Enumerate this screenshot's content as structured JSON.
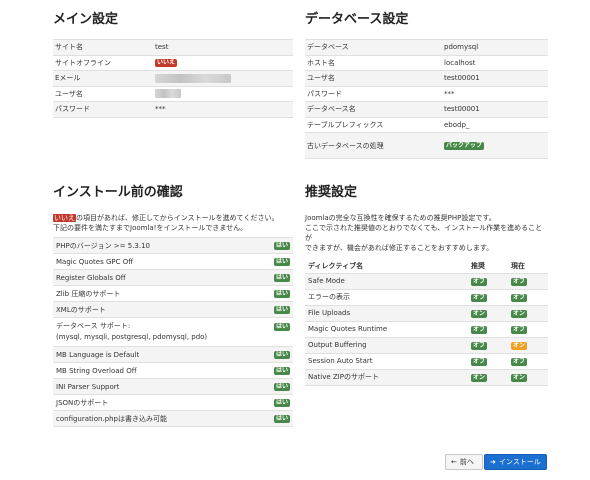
{
  "main_settings": {
    "title": "メイン設定",
    "rows": [
      {
        "label": "サイト名",
        "value": "test"
      },
      {
        "label": "サイトオフライン",
        "badge": "いいえ"
      },
      {
        "label": "Eメール"
      },
      {
        "label": "ユーザ名"
      },
      {
        "label": "パスワード",
        "value": "***"
      }
    ]
  },
  "db_settings": {
    "title": "データベース設定",
    "rows": [
      {
        "label": "データベース",
        "value": "pdomysql"
      },
      {
        "label": "ホスト名",
        "value": "localhost"
      },
      {
        "label": "ユーザ名",
        "value": "test00001"
      },
      {
        "label": "パスワード",
        "value": "***"
      },
      {
        "label": "データベース名",
        "value": "test00001"
      },
      {
        "label": "テーブルプレフィックス",
        "value": "ebodp_"
      },
      {
        "label": "古いデータベースの処理",
        "badge": "バックアップ"
      }
    ]
  },
  "preinstall": {
    "title": "インストール前の確認",
    "intro_badge": "いいえ",
    "intro_rest": "の項目があれば、修正してからインストールを進めてください。",
    "intro_line2": "下記の要件を満たすまでJoomla!をインストールできません。",
    "items": [
      {
        "label": "PHPのバージョン >= 5.3.10",
        "status": "はい"
      },
      {
        "label": "Magic Quotes GPC Off",
        "status": "はい"
      },
      {
        "label": "Register Globals Off",
        "status": "はい"
      },
      {
        "label": "Zlib 圧縮のサポート",
        "status": "はい"
      },
      {
        "label": "XMLのサポート",
        "status": "はい"
      },
      {
        "label": "データベース サポート:",
        "sub": "(mysql, mysqli, postgresql, pdomysql, pdo)",
        "status": "はい"
      },
      {
        "label": "MB Language is Default",
        "status": "はい"
      },
      {
        "label": "MB String Overload Off",
        "status": "はい"
      },
      {
        "label": "INI Parser Support",
        "status": "はい"
      },
      {
        "label": "JSONのサポート",
        "status": "はい"
      },
      {
        "label": "configuration.phpは書き込み可能",
        "status": "はい"
      }
    ]
  },
  "recommended": {
    "title": "推奨設定",
    "intro_line1": "Joomlaの完全な互換性を確保するための推奨PHP設定です。",
    "intro_line2": "ここで示された推奨値のとおりでなくても、インストール作業を進めることが",
    "intro_line3": "できますが、機会があれば修正することをおすすめします。",
    "headers": {
      "directive": "ディレクティブ名",
      "recommended": "推奨",
      "current": "現在"
    },
    "rows": [
      {
        "name": "Safe Mode",
        "rec": "オフ",
        "cur": "オフ",
        "cur_color": "#468847"
      },
      {
        "name": "エラーの表示",
        "rec": "オフ",
        "cur": "オフ",
        "cur_color": "#468847"
      },
      {
        "name": "File Uploads",
        "rec": "オン",
        "cur": "オン",
        "cur_color": "#468847"
      },
      {
        "name": "Magic Quotes Runtime",
        "rec": "オフ",
        "cur": "オフ",
        "cur_color": "#468847"
      },
      {
        "name": "Output Buffering",
        "rec": "オフ",
        "cur": "オン",
        "cur_color": "#f0a020"
      },
      {
        "name": "Session Auto Start",
        "rec": "オフ",
        "cur": "オフ",
        "cur_color": "#468847"
      },
      {
        "name": "Native ZIPのサポート",
        "rec": "オン",
        "cur": "オン",
        "cur_color": "#468847"
      }
    ]
  },
  "buttons": {
    "prev": "前へ",
    "install": "インストール"
  }
}
